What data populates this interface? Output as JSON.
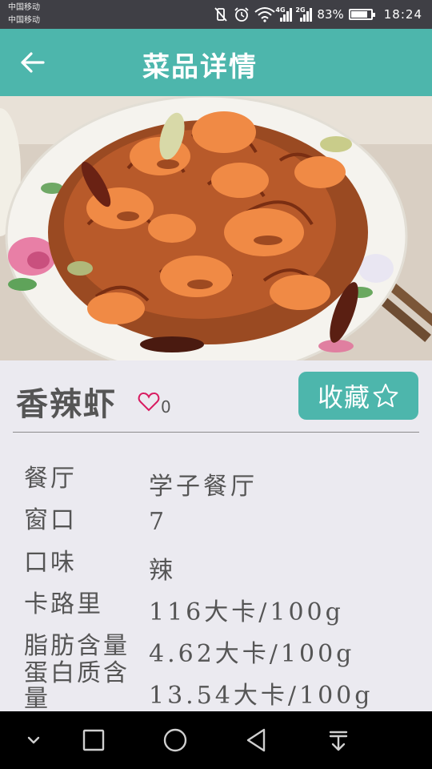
{
  "status_bar": {
    "carrier_1": "中国移动",
    "carrier_2": "中国移动",
    "network_1": "4G",
    "network_2": "2G",
    "battery": "83%",
    "battery_level": 0.83,
    "time": "18:24"
  },
  "app_bar": {
    "title": "菜品详情",
    "back_icon": "arrow-left-icon",
    "background": "#4db6ac"
  },
  "dish": {
    "name": "香辣虾",
    "like_count": "0",
    "favorite_label": "收藏"
  },
  "details": [
    {
      "label": "餐厅",
      "value": "学子餐厅"
    },
    {
      "label": "窗口",
      "value": "7"
    },
    {
      "label": "口味",
      "value": "辣"
    },
    {
      "label": "卡路里",
      "value": "116大卡/100g"
    },
    {
      "label": "脂肪含量",
      "value": "4.62大卡/100g"
    },
    {
      "label": "蛋白质含量",
      "value": "13.54大卡/100g"
    }
  ],
  "nav_bar": {
    "icons": [
      "chevron-down-icon",
      "recent-apps-icon",
      "home-icon",
      "back-triangle-icon",
      "notification-pull-icon"
    ]
  },
  "colors": {
    "accent": "#4db6ac",
    "heart": "#d81b60",
    "page_bg": "#ebeaf0"
  }
}
